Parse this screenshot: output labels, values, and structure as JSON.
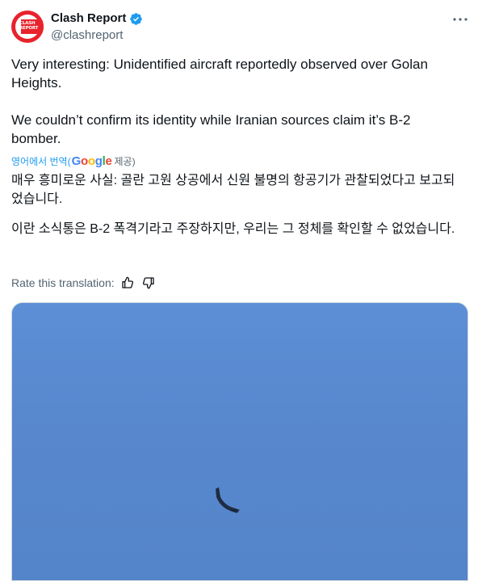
{
  "author": {
    "display_name": "Clash Report",
    "handle": "@clashreport",
    "avatar_text_line1": "CLASH",
    "avatar_text_line2": "REPORT",
    "avatar_color": "#e8232b",
    "verified_color": "#1d9bf0"
  },
  "tweet": {
    "paragraph1": "Very interesting: Unidentified aircraft reportedly observed over Golan Heights.",
    "paragraph2": "We couldn’t confirm its identity while Iranian sources claim it’s B-2 bomber."
  },
  "translation": {
    "link_label": "영어에서 번역(",
    "google_letters": [
      "G",
      "o",
      "o",
      "g",
      "l",
      "e"
    ],
    "provided_label": "제공)",
    "paragraph1": "매우 흥미로운 사실: 골란 고원 상공에서 신원 불명의 항공기가 관찰되었다고 보고되었습니다.",
    "paragraph2": "이란 소식통은 B-2 폭격기라고 주장하지만, 우리는 그 정체를 확인할 수 없었습니다.",
    "rate_label": "Rate this translation:"
  },
  "icons": {
    "more": "more-dots-icon",
    "verified": "verified-badge-icon",
    "thumbs_up": "thumbs-up-icon",
    "thumbs_down": "thumbs-down-icon"
  },
  "colors": {
    "link": "#1d9bf0",
    "secondary_text": "#536471",
    "sky": "#5b8bd0"
  }
}
